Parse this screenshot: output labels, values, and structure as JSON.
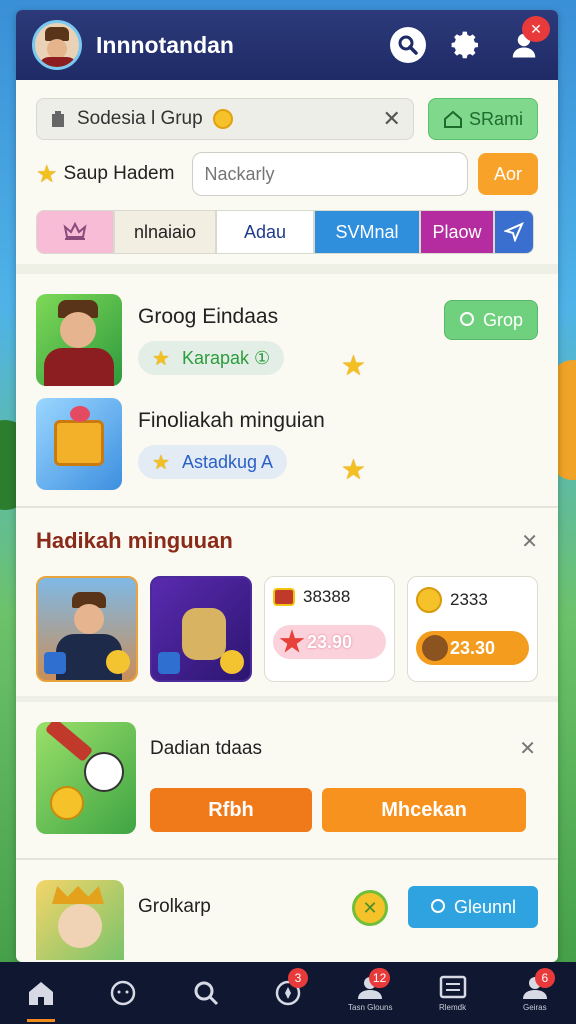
{
  "header": {
    "title": "Innnotandan",
    "notification_badge": "✕"
  },
  "group": {
    "label": "Sodesia l Grup",
    "action_label": "SRami"
  },
  "search_row": {
    "star_label": "Saup Hadem",
    "placeholder": "Nackarly",
    "button_label": "Aor"
  },
  "tabs": [
    {
      "label": ""
    },
    {
      "label": "nlnaiaio"
    },
    {
      "label": "Adau"
    },
    {
      "label": "SVMnal"
    },
    {
      "label": "Plaow"
    },
    {
      "label": ""
    }
  ],
  "items": [
    {
      "title": "Groog Eindaas",
      "pill": "Karapak ①",
      "button": "Grop"
    },
    {
      "title": "Finoliakah minguian",
      "pill": "Astadkug A"
    }
  ],
  "rewards": {
    "title": "Hadikah minguuan",
    "cards": [
      {
        "amount": "38388",
        "bar": "23.90"
      },
      {
        "amount": "2333",
        "bar": "23.30"
      }
    ]
  },
  "action": {
    "title": "Dadian tdaas",
    "button_one": "Rfbh",
    "button_two": "Mhcekan"
  },
  "last": {
    "title": "Grolkarp",
    "button": "Gleunnl"
  },
  "nav": {
    "badge_compass": "3",
    "badge_people": "12",
    "badge_account": "6",
    "caption_people": "Tasn Glouns",
    "caption_account": "Geiras"
  }
}
